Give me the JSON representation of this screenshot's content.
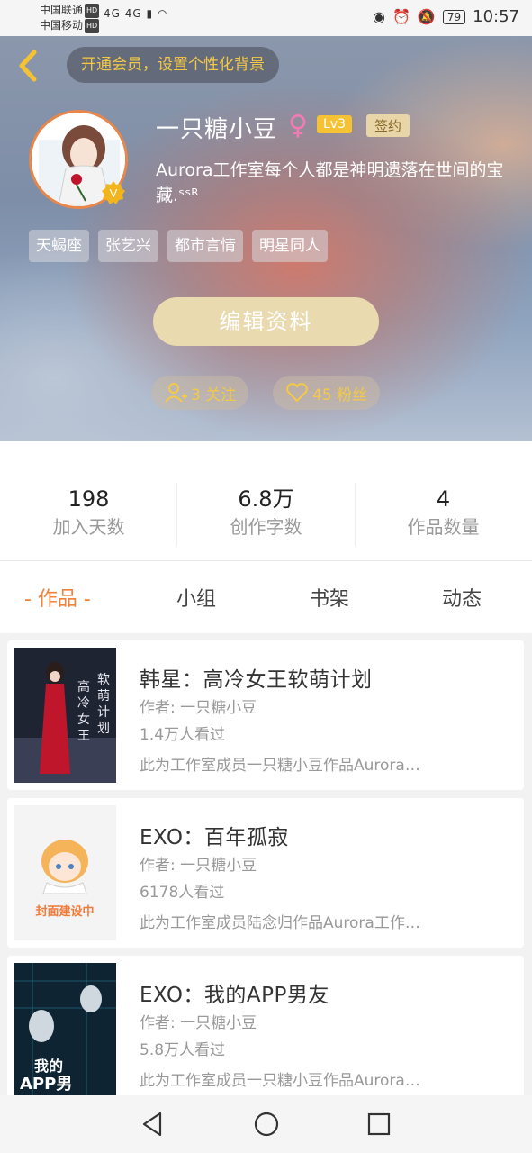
{
  "status_bar": {
    "carrier1": "中国联通",
    "carrier2": "中国移动",
    "hd": "HD",
    "network": "4G 4G",
    "battery": "79",
    "time": "10:57"
  },
  "header": {
    "vip_banner": "开通会员，设置个性化背景",
    "name": "一只糖小豆",
    "gender_symbol": "♀",
    "level": "Lv3",
    "signed_label": "签约",
    "bio": "Aurora工作室每个人都是神明遗落在世间的宝藏.ˢˢᴿ",
    "tags": [
      "天蝎座",
      "张艺兴",
      "都市言情",
      "明星同人"
    ],
    "edit_button": "编辑资料",
    "following": "3 关注",
    "followers": "45 粉丝"
  },
  "stats": [
    {
      "value": "198",
      "label": "加入天数"
    },
    {
      "value": "6.8万",
      "label": "创作字数"
    },
    {
      "value": "4",
      "label": "作品数量"
    }
  ],
  "tabs": [
    {
      "label": "- 作品 -",
      "active": true
    },
    {
      "label": "小组",
      "active": false
    },
    {
      "label": "书架",
      "active": false
    },
    {
      "label": "动态",
      "active": false
    }
  ],
  "works": [
    {
      "title": "韩星：高冷女王软萌计划",
      "author": "作者: 一只糖小豆",
      "views": "1.4万人看过",
      "desc": "此为工作室成员一只糖小豆作品Aurora…",
      "cover_text": "高冷女王 软萌计划"
    },
    {
      "title": "EXO：百年孤寂",
      "author": "作者: 一只糖小豆",
      "views": "6178人看过",
      "desc": "此为工作室成员陆念归作品Aurora工作…",
      "cover_text": "封面建设中"
    },
    {
      "title": "EXO：我的APP男友",
      "author": "作者: 一只糖小豆",
      "views": "5.8万人看过",
      "desc": "此为工作室成员一只糖小豆作品Aurora…",
      "cover_text": "我的APP男友"
    }
  ],
  "colors": {
    "accent": "#f2813a",
    "gold": "#f5c946",
    "edit_button": "#e9dab0"
  }
}
